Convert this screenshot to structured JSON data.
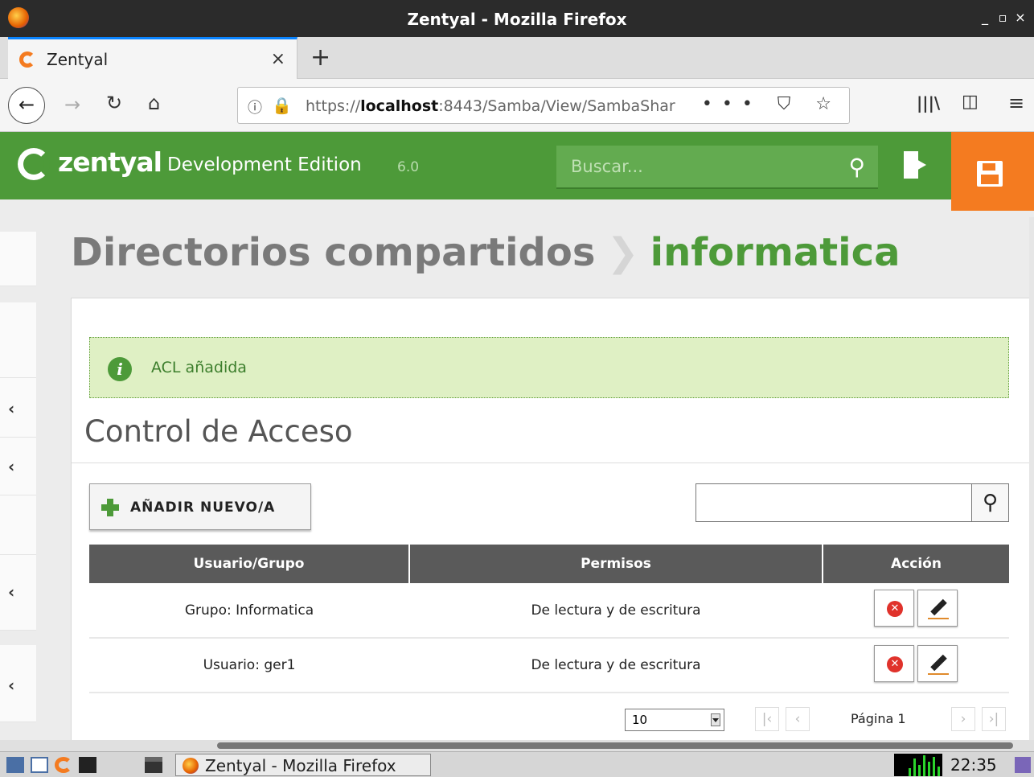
{
  "window": {
    "title": "Zentyal - Mozilla Firefox",
    "controls": [
      "_",
      "▫",
      "×"
    ]
  },
  "browser": {
    "tab_label": "Zentyal",
    "tab_close": "×",
    "new_tab": "+",
    "url_prefix": "https://",
    "url_host": "localhost",
    "url_rest": ":8443/Samba/View/SambaShar",
    "url_icons": "••• ⛉ ☆"
  },
  "zentyal": {
    "brand": "zentyal",
    "edition": "Development Edition",
    "version": "6.0",
    "search_placeholder": "Buscar..."
  },
  "breadcrumb": {
    "parent": "Directorios compartidos",
    "separator": "❯",
    "current": "informatica"
  },
  "message": {
    "icon": "i",
    "text": "ACL añadida"
  },
  "section": {
    "title": "Control de Acceso",
    "add_button": "AÑADIR NUEVO/A"
  },
  "table": {
    "headers": [
      "Usuario/Grupo",
      "Permisos",
      "Acción"
    ],
    "rows": [
      {
        "who": "Grupo: Informatica",
        "perm": "De lectura y de escritura"
      },
      {
        "who": "Usuario: ger1",
        "perm": "De lectura y de escritura"
      }
    ]
  },
  "pager": {
    "page_size": "10",
    "page_label": "Página 1"
  },
  "taskbar": {
    "task_label": "Zentyal - Mozilla Firefox",
    "clock": "22:35"
  },
  "colors": {
    "zentyal_green": "#4d9a39",
    "save_orange": "#f47b20",
    "message_bg": "#dff0c4",
    "table_header": "#5a5a5a"
  },
  "icons": [
    "firefox-icon",
    "zentyal-icon",
    "search-icon",
    "logout-icon",
    "save-icon",
    "info-icon",
    "add-icon",
    "delete-icon",
    "edit-icon"
  ]
}
